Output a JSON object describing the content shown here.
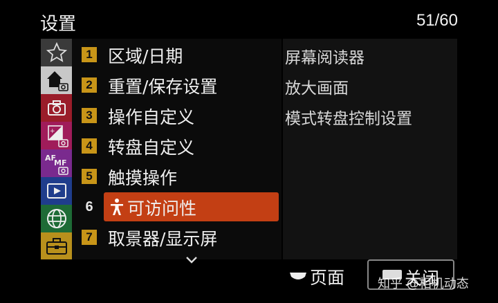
{
  "header": {
    "title": "设置",
    "page_counter": "51/60"
  },
  "sidebar": {
    "tabs": [
      {
        "icon": "star-icon",
        "color": "#3a3a3a"
      },
      {
        "icon": "home-camera-icon",
        "color": "#c8c8c8"
      },
      {
        "icon": "camera-icon",
        "color": "#9a1d2a"
      },
      {
        "icon": "exposure-camera-icon",
        "color": "#a01c5a"
      },
      {
        "icon": "af-mf-camera-icon",
        "color": "#7a2a8e"
      },
      {
        "icon": "playback-icon",
        "color": "#1f3d8c"
      },
      {
        "icon": "globe-icon",
        "color": "#1e6b36"
      },
      {
        "icon": "toolbox-icon",
        "color": "#b8901c"
      }
    ]
  },
  "menu": {
    "items": [
      {
        "num": "1",
        "label": "区域/日期"
      },
      {
        "num": "2",
        "label": "重置/保存设置"
      },
      {
        "num": "3",
        "label": "操作自定义"
      },
      {
        "num": "4",
        "label": "转盘自定义"
      },
      {
        "num": "5",
        "label": "触摸操作"
      },
      {
        "num": "6",
        "label": "可访问性"
      },
      {
        "num": "7",
        "label": "取景器/显示屏"
      }
    ]
  },
  "detail": {
    "items": [
      "屏幕阅读器",
      "放大画面",
      "模式转盘控制设置"
    ]
  },
  "footer": {
    "page_label": "页面",
    "close_label": "关闭"
  },
  "watermark": "知乎 @相机动态",
  "colors": {
    "selected": "#c33f14",
    "number_badge": "#c89518"
  }
}
